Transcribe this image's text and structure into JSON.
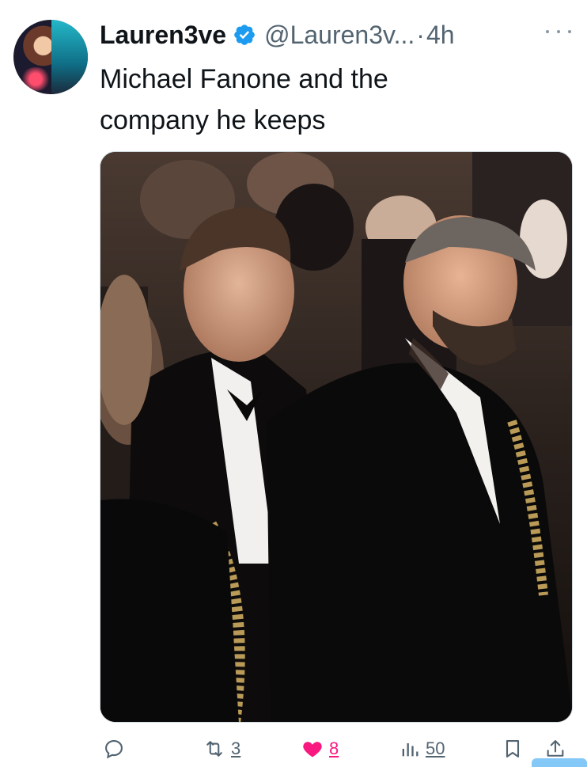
{
  "author": {
    "display_name": "Lauren3ve",
    "verified": true,
    "handle": "@Lauren3v...",
    "separator": "·",
    "time": "4h"
  },
  "tweet": {
    "text_line1": "Michael Fanone and the",
    "text_line2": "company he keeps"
  },
  "media": {
    "description_icon": "photo"
  },
  "actions": {
    "reply_count": "",
    "retweet_count": "3",
    "like_count": "8",
    "views_count": "50"
  },
  "colors": {
    "accent": "#1d9bf0",
    "like": "#f91880",
    "secondary_text": "#536471",
    "primary_text": "#0f1419"
  }
}
